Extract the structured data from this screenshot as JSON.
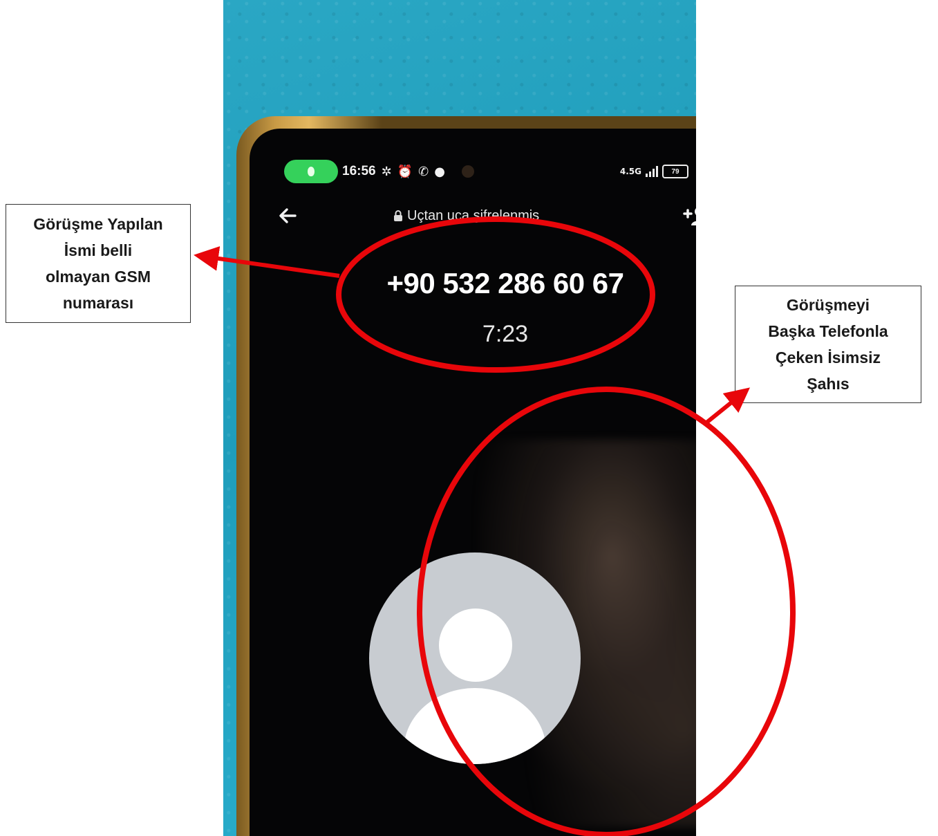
{
  "status_bar": {
    "time": "16:56",
    "network": "4.5G",
    "battery": "79"
  },
  "call": {
    "encryption_label": "Uçtan uca şifrelenmiş",
    "phone_number": "+90 532 286 60 67",
    "duration": "7:23"
  },
  "annotations": {
    "left_callout_lines": [
      "Görüşme Yapılan",
      "İsmi belli",
      "olmayan GSM",
      "numarası"
    ],
    "right_callout_lines": [
      "Görüşmeyi",
      "Başka Telefonla",
      "Çeken İsimsiz",
      "Şahıs"
    ],
    "highlight_color": "#e8060a"
  },
  "colors": {
    "background_cloth": "#1f9dbb",
    "screen": "#050506",
    "status_pill": "#35d15b"
  }
}
